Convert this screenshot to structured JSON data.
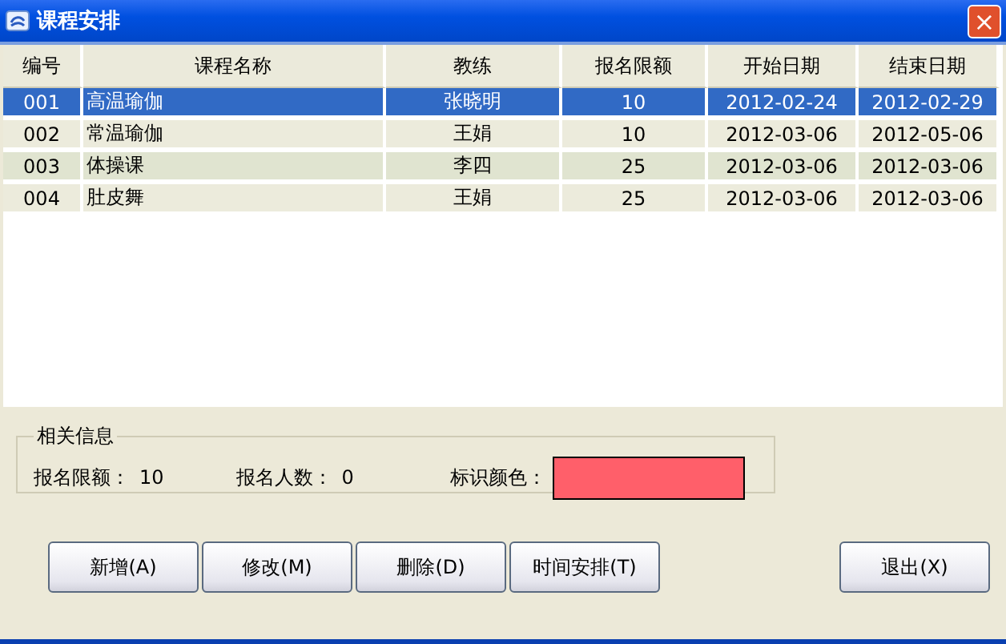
{
  "window": {
    "title": "课程安排",
    "close": "×"
  },
  "table": {
    "columns": [
      "编号",
      "课程名称",
      "教练",
      "报名限额",
      "开始日期",
      "结束日期"
    ],
    "rows": [
      {
        "selected": true,
        "cells": [
          "001",
          "高温瑜伽",
          "张晓明",
          "10",
          "2012-02-24",
          "2012-02-29"
        ]
      },
      {
        "selected": false,
        "cells": [
          "002",
          "常温瑜伽",
          "王娟",
          "10",
          "2012-03-06",
          "2012-05-06"
        ]
      },
      {
        "selected": false,
        "cells": [
          "003",
          "体操课",
          "李四",
          "25",
          "2012-03-06",
          "2012-03-06"
        ]
      },
      {
        "selected": false,
        "cells": [
          "004",
          "肚皮舞",
          "王娟",
          "25",
          "2012-03-06",
          "2012-03-06"
        ]
      }
    ]
  },
  "info": {
    "title": "相关信息",
    "quota_label": "报名限额：",
    "quota": "10",
    "count_label": "报名人数：",
    "count": "0",
    "color_label": "标识颜色：",
    "color": "#ff5f6a"
  },
  "buttons": [
    "新增(A)",
    "修改(M)",
    "删除(D)",
    "时间安排(T)"
  ],
  "exit_button": "退出(X)"
}
